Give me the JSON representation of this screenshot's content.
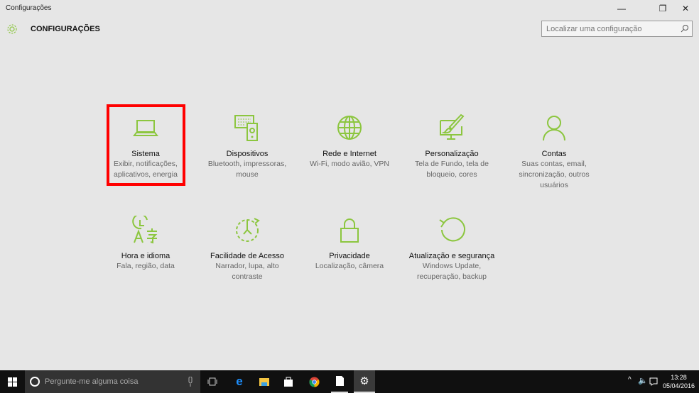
{
  "window": {
    "title": "Configurações",
    "minimize": "—",
    "maximize": "❐",
    "close": "✕"
  },
  "header": {
    "title": "CONFIGURAÇÕES",
    "search_placeholder": "Localizar uma configuração"
  },
  "tiles": [
    {
      "title": "Sistema",
      "desc": "Exibir, notificações, aplicativos, energia",
      "icon": "laptop-icon",
      "selected": true
    },
    {
      "title": "Dispositivos",
      "desc": "Bluetooth, impressoras, mouse",
      "icon": "devices-icon"
    },
    {
      "title": "Rede e Internet",
      "desc": "Wi-Fi, modo avião, VPN",
      "icon": "globe-icon"
    },
    {
      "title": "Personalização",
      "desc": "Tela de Fundo, tela de bloqueio, cores",
      "icon": "paint-icon"
    },
    {
      "title": "Contas",
      "desc": "Suas contas, email, sincronização, outros usuários",
      "icon": "person-icon"
    },
    {
      "title": "Hora e idioma",
      "desc": "Fala, região, data",
      "icon": "time-language-icon"
    },
    {
      "title": "Facilidade de Acesso",
      "desc": "Narrador, lupa, alto contraste",
      "icon": "ease-of-access-icon"
    },
    {
      "title": "Privacidade",
      "desc": "Localização, câmera",
      "icon": "lock-icon"
    },
    {
      "title": "Atualização e segurança",
      "desc": "Windows Update, recuperação, backup",
      "icon": "update-icon"
    }
  ],
  "taskbar": {
    "search_placeholder": "Pergunte-me alguma coisa",
    "time": "13:28",
    "date": "05/04/2016"
  },
  "colors": {
    "accent": "#8cc63f",
    "selection": "#ff0000"
  }
}
